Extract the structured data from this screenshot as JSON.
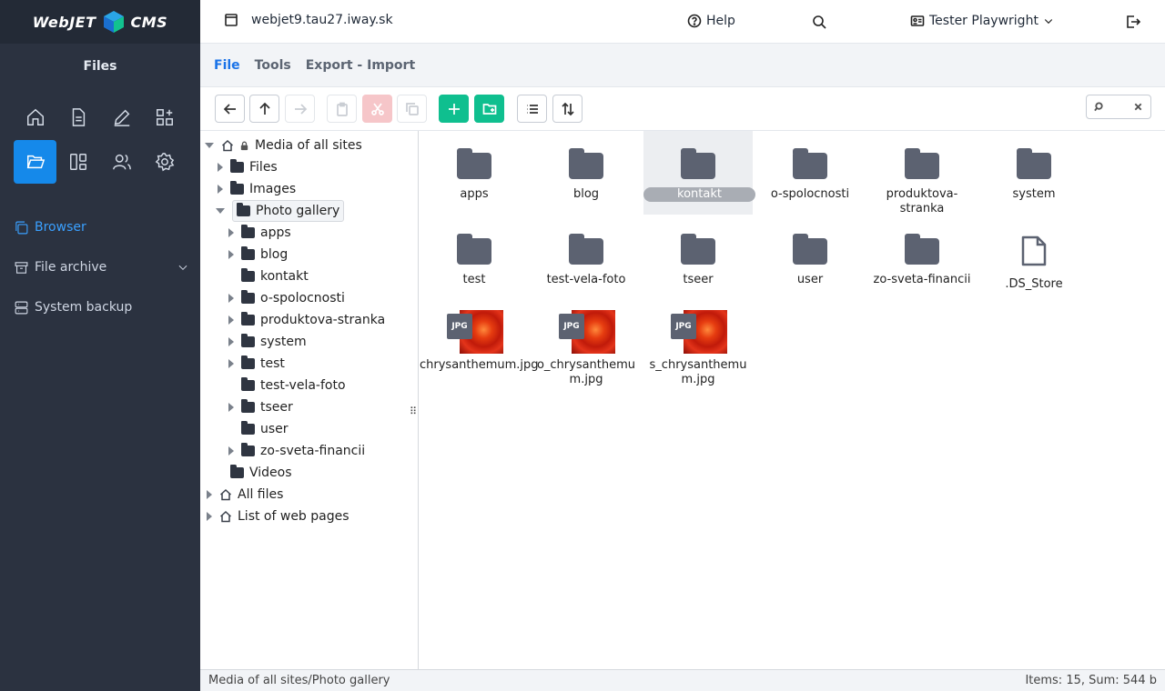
{
  "brand": {
    "left": "WebJET",
    "right": "CMS"
  },
  "sidebar": {
    "title": "Files",
    "menu": [
      {
        "label": "Browser",
        "active": true
      },
      {
        "label": "File archive"
      },
      {
        "label": "System backup"
      }
    ]
  },
  "header": {
    "domain": "webjet9.tau27.iway.sk",
    "help": "Help",
    "user": "Tester Playwright"
  },
  "tabs": [
    "File",
    "Tools",
    "Export - Import"
  ],
  "tree": {
    "root": "Media of all sites",
    "nodes": [
      "Files",
      "Images",
      "Photo gallery"
    ],
    "children": [
      "apps",
      "blog",
      "kontakt",
      "o-spolocnosti",
      "produktova-stranka",
      "system",
      "test",
      "test-vela-foto",
      "tseer",
      "user",
      "zo-sveta-financii"
    ],
    "after": [
      "Videos"
    ],
    "other_roots": [
      "All files",
      "List of web pages"
    ]
  },
  "files": {
    "folders": [
      "apps",
      "blog",
      "kontakt",
      "o-spolocnosti",
      "produktova-stranka",
      "system",
      "test",
      "test-vela-foto",
      "tseer",
      "user",
      "zo-sveta-financii"
    ],
    "doc": ".DS_Store",
    "images": [
      {
        "name": "chrysanthemum.jpg",
        "badge": "JPG"
      },
      {
        "name": "o_chrysanthemum.jpg",
        "badge": "JPG"
      },
      {
        "name": "s_chrysanthemum.jpg",
        "badge": "JPG"
      }
    ],
    "selected": "kontakt"
  },
  "status": {
    "path": "Media of all sites/Photo gallery",
    "summary": "Items: 15, Sum: 544 b"
  },
  "colors": {
    "accent": "#1589ea",
    "green": "#0fbf8f",
    "sidebar": "#2b3240"
  }
}
